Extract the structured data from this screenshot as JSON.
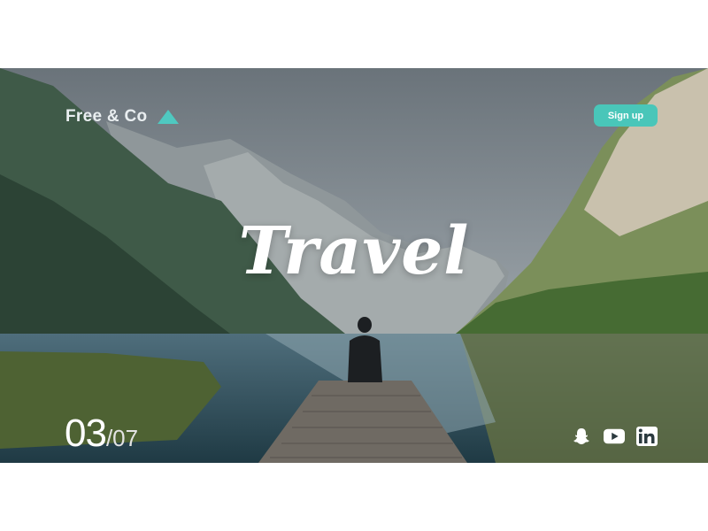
{
  "header": {
    "brand": "Free & Co",
    "signup_label": "Sign up"
  },
  "hero": {
    "headline": "Travel"
  },
  "slider": {
    "current": "03",
    "total": "/07"
  },
  "social": [
    "snapchat-icon",
    "youtube-icon",
    "linkedin-icon"
  ],
  "colors": {
    "accent": "#49c6b9",
    "text": "#ffffff"
  }
}
